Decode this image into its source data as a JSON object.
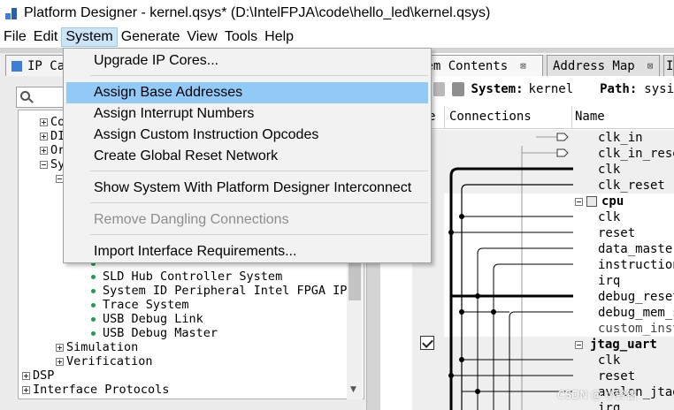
{
  "window": {
    "title": "Platform Designer - kernel.qsys* (D:\\IntelFPJA\\code\\hello_led\\kernel.qsys)"
  },
  "menubar": {
    "items": [
      "File",
      "Edit",
      "System",
      "Generate",
      "View",
      "Tools",
      "Help"
    ],
    "active": "System"
  },
  "system_menu": {
    "items": [
      {
        "label": "Upgrade IP Cores...",
        "state": "normal"
      },
      {
        "label": "Assign Base Addresses",
        "state": "highlighted"
      },
      {
        "label": "Assign Interrupt Numbers",
        "state": "normal"
      },
      {
        "label": "Assign Custom Instruction Opcodes",
        "state": "normal"
      },
      {
        "label": "Create Global Reset Network",
        "state": "normal"
      },
      {
        "label": "Show System With Platform Designer Interconnect",
        "state": "normal"
      },
      {
        "label": "Remove Dangling Connections",
        "state": "disabled"
      },
      {
        "label": "Import Interface Requirements...",
        "state": "normal"
      }
    ]
  },
  "ip_catalog": {
    "tab_label": "IP Ca",
    "tree_partial": [
      "Co",
      "DI",
      "Or",
      "Sy"
    ],
    "tree": {
      "partial_item": "SLD Hub Controller",
      "items": [
        "SLD Hub Controller System",
        "System ID Peripheral Intel FPGA IP",
        "Trace System",
        "USB Debug Link",
        "USB Debug Master"
      ],
      "groups": [
        "Simulation",
        "Verification"
      ],
      "top_level": [
        "DSP",
        "Interface Protocols"
      ]
    }
  },
  "system_contents": {
    "tabs": [
      {
        "label": "tem Contents",
        "active": true
      },
      {
        "label": "Address Map",
        "active": false
      },
      {
        "label": "I",
        "active": false
      }
    ],
    "toolbar": {
      "system_label": "System:",
      "system_value": "kernel",
      "path_label": "Path:",
      "path_value": "sysi"
    },
    "columns": [
      "e",
      "Connections",
      "Name"
    ],
    "rows": [
      {
        "name": "clk_in",
        "shade": true,
        "bold": false
      },
      {
        "name": "clk_in_rese",
        "shade": true,
        "bold": false
      },
      {
        "name": "clk",
        "shade": true,
        "bold": false
      },
      {
        "name": "clk_reset",
        "shade": true,
        "bold": false
      },
      {
        "name": "cpu",
        "shade": false,
        "bold": true
      },
      {
        "name": "clk",
        "shade": false,
        "bold": false
      },
      {
        "name": "reset",
        "shade": false,
        "bold": false
      },
      {
        "name": "data_master",
        "shade": false,
        "bold": false
      },
      {
        "name": "instruction",
        "shade": false,
        "bold": false
      },
      {
        "name": "irq",
        "shade": false,
        "bold": false
      },
      {
        "name": "debug_reset",
        "shade": false,
        "bold": false
      },
      {
        "name": "debug_mem_s",
        "shade": false,
        "bold": false
      },
      {
        "name": "custom_inst",
        "shade": false,
        "bold": false
      },
      {
        "name": "jtag_uart",
        "shade": true,
        "bold": true
      },
      {
        "name": "clk",
        "shade": true,
        "bold": false
      },
      {
        "name": "reset",
        "shade": true,
        "bold": false
      },
      {
        "name": "avalon_jtag",
        "shade": true,
        "bold": false
      },
      {
        "name": "irq",
        "shade": true,
        "bold": false
      }
    ]
  },
  "watermark": {
    "text": "CSDN @ 小铃钻"
  },
  "colors": {
    "menu_highlight": "#91c9f7",
    "menu_active": "#cce4f7",
    "tree_dot": "#1aa34a"
  }
}
